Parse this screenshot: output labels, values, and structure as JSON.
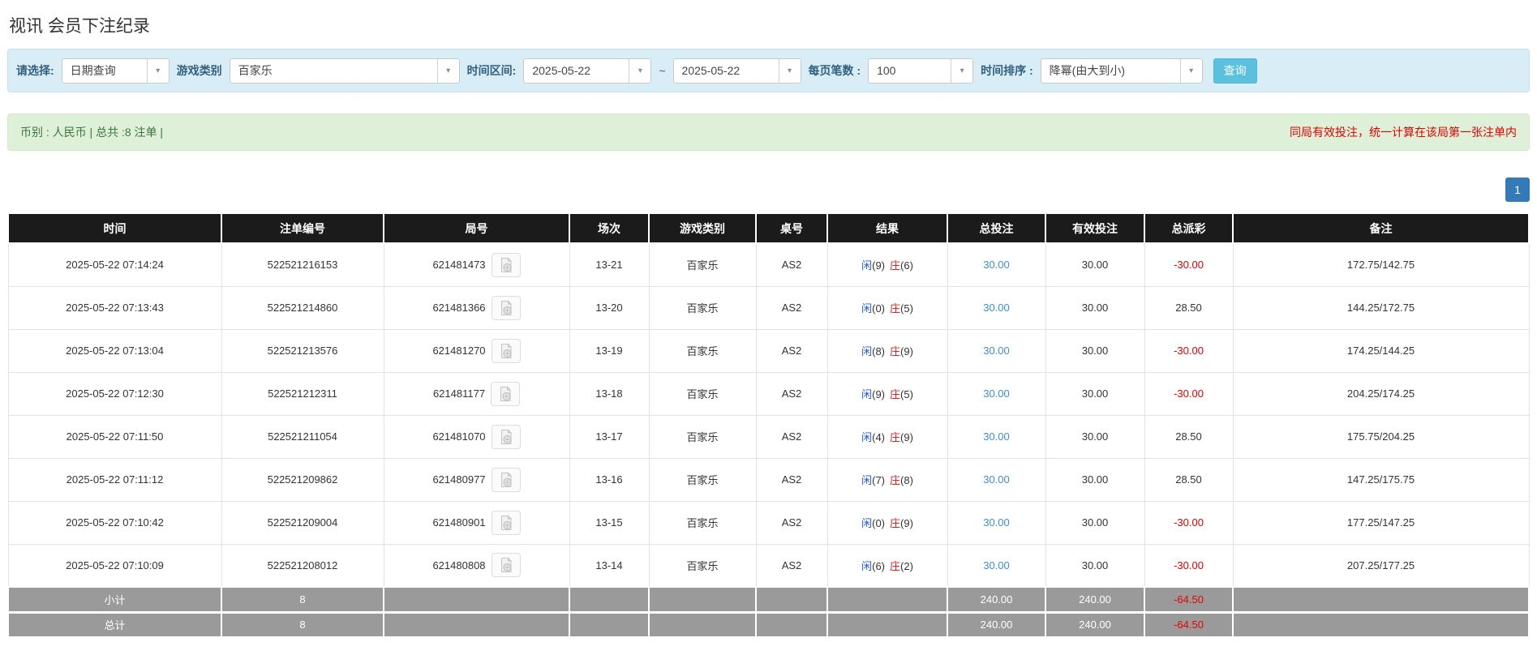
{
  "page_title": "视讯 会员下注纪录",
  "filter_bar": {
    "query_type": {
      "label": "请选择:",
      "value": "日期查询"
    },
    "game_type": {
      "label": "游戏类别",
      "value": "百家乐"
    },
    "date_range": {
      "label": "时间区间:",
      "from": "2025-05-22",
      "separator": "~",
      "to": "2025-05-22"
    },
    "page_size": {
      "label": "每页笔数 :",
      "value": "100"
    },
    "time_sort": {
      "label": "时间排序 :",
      "value": "降幂(由大到小)"
    },
    "search_button_label": "查询"
  },
  "summary_bar": {
    "currency_info": "币别 : 人民币 | 总共 :8 注单 |",
    "notice": "同局有效投注，统一计算在该局第一张注单内"
  },
  "pagination": {
    "page": "1"
  },
  "table": {
    "headers": [
      "时间",
      "注单编号",
      "局号",
      "场次",
      "游戏类别",
      "桌号",
      "结果",
      "总投注",
      "有效投注",
      "总派彩",
      "备注"
    ],
    "rows": [
      {
        "time": "2025-05-22 07:14:24",
        "bet_id": "522521216153",
        "round_id": "621481473",
        "session": "13-21",
        "game": "百家乐",
        "table_no": "AS2",
        "player_label": "闲",
        "player_score": "(9)",
        "banker_label": "庄",
        "banker_score": "(6)",
        "total_bet": "30.00",
        "valid_bet": "30.00",
        "total_payout": "-30.00",
        "note": "172.75/142.75"
      },
      {
        "time": "2025-05-22 07:13:43",
        "bet_id": "522521214860",
        "round_id": "621481366",
        "session": "13-20",
        "game": "百家乐",
        "table_no": "AS2",
        "player_label": "闲",
        "player_score": "(0)",
        "banker_label": "庄",
        "banker_score": "(5)",
        "total_bet": "30.00",
        "valid_bet": "30.00",
        "total_payout": "28.50",
        "note": "144.25/172.75"
      },
      {
        "time": "2025-05-22 07:13:04",
        "bet_id": "522521213576",
        "round_id": "621481270",
        "session": "13-19",
        "game": "百家乐",
        "table_no": "AS2",
        "player_label": "闲",
        "player_score": "(8)",
        "banker_label": "庄",
        "banker_score": "(9)",
        "total_bet": "30.00",
        "valid_bet": "30.00",
        "total_payout": "-30.00",
        "note": "174.25/144.25"
      },
      {
        "time": "2025-05-22 07:12:30",
        "bet_id": "522521212311",
        "round_id": "621481177",
        "session": "13-18",
        "game": "百家乐",
        "table_no": "AS2",
        "player_label": "闲",
        "player_score": "(9)",
        "banker_label": "庄",
        "banker_score": "(5)",
        "total_bet": "30.00",
        "valid_bet": "30.00",
        "total_payout": "-30.00",
        "note": "204.25/174.25"
      },
      {
        "time": "2025-05-22 07:11:50",
        "bet_id": "522521211054",
        "round_id": "621481070",
        "session": "13-17",
        "game": "百家乐",
        "table_no": "AS2",
        "player_label": "闲",
        "player_score": "(4)",
        "banker_label": "庄",
        "banker_score": "(9)",
        "total_bet": "30.00",
        "valid_bet": "30.00",
        "total_payout": "28.50",
        "note": "175.75/204.25"
      },
      {
        "time": "2025-05-22 07:11:12",
        "bet_id": "522521209862",
        "round_id": "621480977",
        "session": "13-16",
        "game": "百家乐",
        "table_no": "AS2",
        "player_label": "闲",
        "player_score": "(7)",
        "banker_label": "庄",
        "banker_score": "(8)",
        "total_bet": "30.00",
        "valid_bet": "30.00",
        "total_payout": "28.50",
        "note": "147.25/175.75"
      },
      {
        "time": "2025-05-22 07:10:42",
        "bet_id": "522521209004",
        "round_id": "621480901",
        "session": "13-15",
        "game": "百家乐",
        "table_no": "AS2",
        "player_label": "闲",
        "player_score": "(0)",
        "banker_label": "庄",
        "banker_score": "(9)",
        "total_bet": "30.00",
        "valid_bet": "30.00",
        "total_payout": "-30.00",
        "note": "177.25/147.25"
      },
      {
        "time": "2025-05-22 07:10:09",
        "bet_id": "522521208012",
        "round_id": "621480808",
        "session": "13-14",
        "game": "百家乐",
        "table_no": "AS2",
        "player_label": "闲",
        "player_score": "(6)",
        "banker_label": "庄",
        "banker_score": "(2)",
        "total_bet": "30.00",
        "valid_bet": "30.00",
        "total_payout": "-30.00",
        "note": "207.25/177.25"
      }
    ],
    "footer": [
      {
        "label": "小计",
        "count": "8",
        "total_bet": "240.00",
        "valid_bet": "240.00",
        "total_payout": "-64.50"
      },
      {
        "label": "总计",
        "count": "8",
        "total_bet": "240.00",
        "valid_bet": "240.00",
        "total_payout": "-64.50"
      }
    ]
  },
  "colors": {
    "filter_bar_bg": "#d9edf7",
    "summary_bar_bg": "#dff0d8",
    "summary_text_green": "#3c763d",
    "notice_red": "#e10000",
    "player_blue": "#2159d6",
    "banker_red": "#e01f1f",
    "bet_amount_blue": "#3e8ddd",
    "negative_red": "#e60000",
    "table_header_bg": "#1b1b1b",
    "table_footer_bg": "#9a9a9a",
    "search_button_cyan": "#5bc0de",
    "pagination_blue": "#337ab7"
  },
  "icons": {
    "select_caret": "chevron-down-icon",
    "round_cell_icon": "video-record-file-icon"
  }
}
